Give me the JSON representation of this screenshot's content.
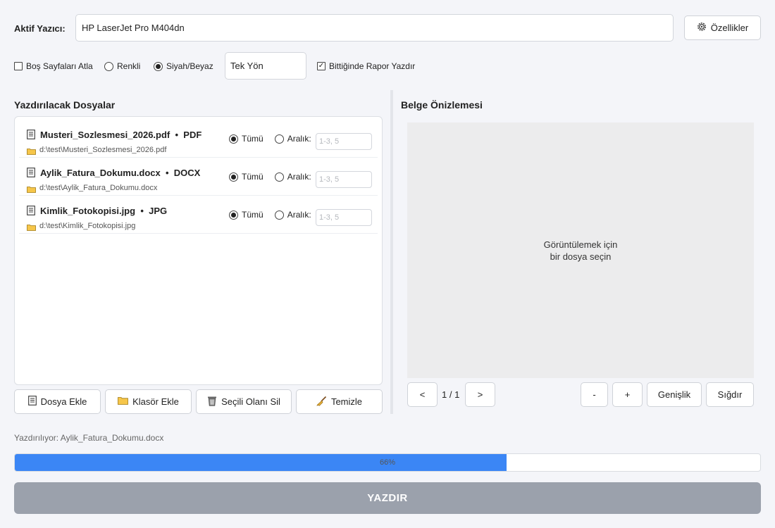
{
  "printer": {
    "label": "Aktif Yazıcı:",
    "value": "HP LaserJet Pro M404dn",
    "properties_label": "Özellikler",
    "properties_icon": "gear-icon"
  },
  "options": {
    "skip_blank_label": "Boş Sayfaları Atla",
    "skip_blank_checked": false,
    "color_label": "Renkli",
    "bw_label": "Siyah/Beyaz",
    "selected_color_mode": "Siyah/Beyaz",
    "duplex_value": "Tek Yön",
    "report_label": "Bittiğinde Rapor Yazdır",
    "report_checked": true
  },
  "files_section": {
    "title": "Yazdırılacak Dosyalar",
    "all_label": "Tümü",
    "range_label": "Aralık:",
    "range_placeholder": "1-3, 5",
    "separator": "•",
    "files": [
      {
        "name": "Musteri_Sozlesmesi_2026.pdf",
        "type": "PDF",
        "path": "d:\\test\\Musteri_Sozlesmesi_2026.pdf",
        "mode": "all"
      },
      {
        "name": "Aylik_Fatura_Dokumu.docx",
        "type": "DOCX",
        "path": "d:\\test\\Aylik_Fatura_Dokumu.docx",
        "mode": "all"
      },
      {
        "name": "Kimlik_Fotokopisi.jpg",
        "type": "JPG",
        "path": "d:\\test\\Kimlik_Fotokopisi.jpg",
        "mode": "all"
      }
    ],
    "buttons": {
      "add_file": "Dosya Ekle",
      "add_folder": "Klasör Ekle",
      "delete_selected": "Seçili Olanı Sil",
      "clear": "Temizle"
    }
  },
  "preview": {
    "title": "Belge Önizlemesi",
    "placeholder_line1": "Görüntülemek için",
    "placeholder_line2": "bir dosya seçin",
    "prev_label": "<",
    "page_indicator": "1 / 1",
    "next_label": ">",
    "zoom_out_label": "-",
    "zoom_in_label": "+",
    "fit_width_label": "Genişlik",
    "fit_label": "Sığdır"
  },
  "status": {
    "text": "Yazdırılıyor: Aylik_Fatura_Dokumu.docx",
    "progress": 0.66,
    "progress_text": "66%"
  },
  "print_button": {
    "label": "YAZDIR"
  },
  "colors": {
    "accent": "#3b86f5",
    "background": "#f4f5f9",
    "print_button": "#9ba1ac"
  }
}
